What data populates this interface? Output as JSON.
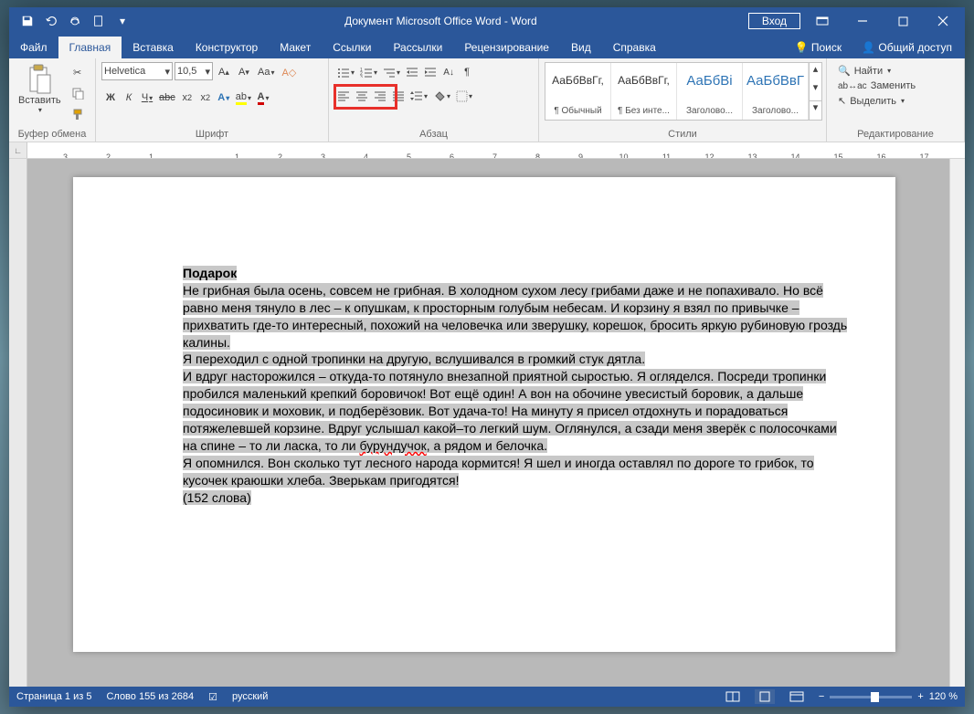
{
  "titlebar": {
    "title": "Документ Microsoft Office Word  -  Word",
    "signin": "Вход"
  },
  "tabs": {
    "file": "Файл",
    "home": "Главная",
    "insert": "Вставка",
    "design": "Конструктор",
    "layout": "Макет",
    "references": "Ссылки",
    "mailings": "Рассылки",
    "review": "Рецензирование",
    "view": "Вид",
    "help": "Справка",
    "search": "Поиск",
    "share": "Общий доступ"
  },
  "ribbon": {
    "clipboard": {
      "paste": "Вставить",
      "label": "Буфер обмена"
    },
    "font": {
      "name": "Helvetica",
      "size": "10,5",
      "label": "Шрифт"
    },
    "paragraph": {
      "label": "Абзац"
    },
    "styles": {
      "label": "Стили",
      "items": [
        {
          "preview": "АаБбВвГг,",
          "name": "¶ Обычный",
          "blue": false
        },
        {
          "preview": "АаБбВвГг,",
          "name": "¶ Без инте...",
          "blue": false
        },
        {
          "preview": "АаБбВі",
          "name": "Заголово...",
          "blue": true
        },
        {
          "preview": "АаБбВвГ",
          "name": "Заголово...",
          "blue": true
        }
      ]
    },
    "editing": {
      "find": "Найти",
      "replace": "Заменить",
      "select": "Выделить",
      "label": "Редактирование"
    }
  },
  "document": {
    "title": "Подарок",
    "p1": "Не грибная была осень, совсем не грибная. В холодном сухом лесу грибами даже и не попахивало. Но всё равно меня тянуло в лес – к опушкам, к просторным голубым небесам. И корзину я взял по привычке – прихватить где-то интересный, похожий на человечка или зверушку, корешок, бросить яркую рубиновую гроздь калины.",
    "p2": "Я переходил с одной тропинки на другую, вслушивался в громкий стук дятла.",
    "p3a": "И вдруг насторожился – откуда-то потянуло внезапной приятной сыростью. Я огляделся. Посреди тропинки пробился маленький крепкий боровичок! Вот ещё один! А вон на обочине увесистый боровик, а дальше подосиновик и моховик, и подберёзовик. Вот удача-то! На минуту я присел отдохнуть и порадоваться потяжелевшей корзине. Вдруг услышал какой–то легкий шум. Оглянулся, а сзади меня зверёк с полосочками на спине – то ли ласка, то ли ",
    "p3spell": "бурундучок",
    "p3b": ", а рядом и белочка.",
    "p4": "Я опомнился. Вон сколько тут лесного народа кормится! Я шел и иногда оставлял по дороге то грибок, то кусочек краюшки хлеба. Зверькам пригодятся!",
    "p5": "(152 слова)"
  },
  "statusbar": {
    "page": "Страница 1 из 5",
    "words": "Слово 155 из 2684",
    "lang": "русский",
    "zoom": "120 %"
  },
  "ruler": {
    "nums": [
      "3",
      "2",
      "1",
      "",
      "1",
      "2",
      "3",
      "4",
      "5",
      "6",
      "7",
      "8",
      "9",
      "10",
      "11",
      "12",
      "13",
      "14",
      "15",
      "16",
      "17"
    ]
  }
}
